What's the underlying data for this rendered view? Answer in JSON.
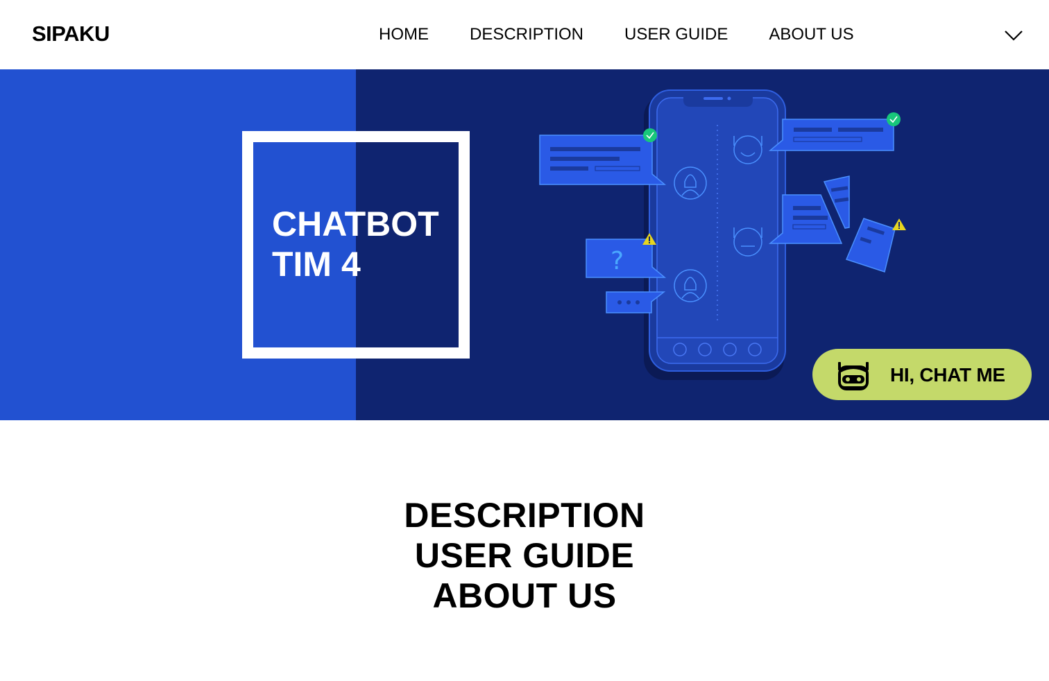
{
  "header": {
    "logo": "SIPAKU",
    "nav": [
      "HOME",
      "DESCRIPTION",
      "USER GUIDE",
      "ABOUT US"
    ],
    "menu_icon": "chevron-down-icon"
  },
  "hero": {
    "title_line1": "CHATBOT",
    "title_line2": "TIM 4",
    "illustration": "phone-chat-illustration",
    "illustration_question_mark": "?",
    "colors": {
      "left_panel": "#2251d1",
      "right_panel": "#0f2470",
      "accent_green": "#18c77b",
      "accent_yellow": "#e7d51f"
    }
  },
  "chat_button": {
    "label": "HI, CHAT ME",
    "icon": "robot-icon",
    "color": "#c4d96a"
  },
  "sections": {
    "links": [
      "DESCRIPTION",
      "USER GUIDE",
      "ABOUT US"
    ]
  }
}
